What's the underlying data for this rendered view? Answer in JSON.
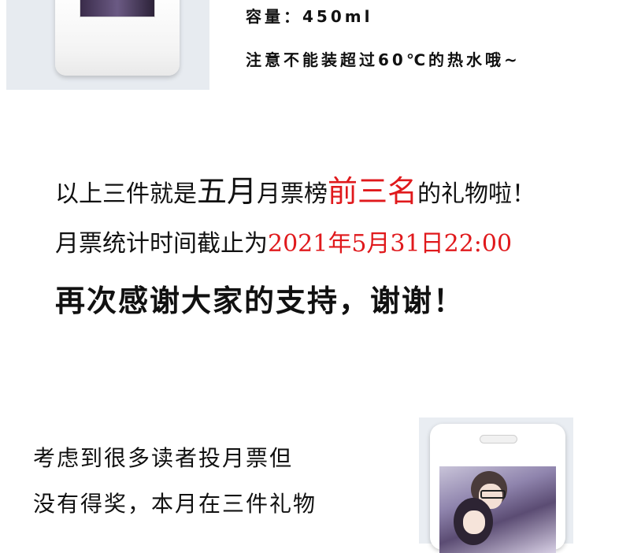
{
  "spec": {
    "capacity": "容量：450ml",
    "note": "注意不能装超过60℃的热水哦~"
  },
  "announcement": {
    "line1_a": "以上三件就是",
    "line1_month": "五月",
    "line1_b": "月票榜",
    "line1_top3": "前三名",
    "line1_c": "的礼物啦！",
    "line2_a": "月票统计时间截止为",
    "line2_deadline": "2021年5月31日22:00",
    "line3": "再次感谢大家的支持，谢谢！"
  },
  "bottom_text": {
    "line1": "考虑到很多读者投月票但",
    "line2": "没有得奖，本月在三件礼物"
  },
  "colors": {
    "highlight": "#e0191c",
    "text": "#111111",
    "photo_bg": "#e7ebf0"
  }
}
